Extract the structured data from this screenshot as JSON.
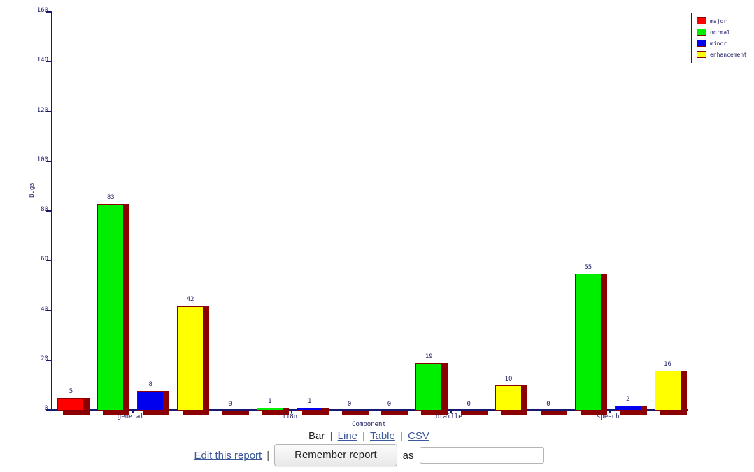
{
  "chart_data": {
    "type": "bar",
    "title": "",
    "xlabel": "Component",
    "ylabel": "Bugs",
    "ylim": [
      0,
      160
    ],
    "yticks": [
      0,
      20,
      40,
      60,
      80,
      100,
      120,
      140,
      160
    ],
    "grid": false,
    "legend_position": "right",
    "categories": [
      "general",
      "i18n",
      "braille",
      "speech"
    ],
    "series": [
      {
        "name": "major",
        "color": "#ff0000",
        "values": [
          5,
          0,
          0,
          0
        ]
      },
      {
        "name": "normal",
        "color": "#00ee00",
        "values": [
          83,
          1,
          19,
          55
        ]
      },
      {
        "name": "minor",
        "color": "#0000ee",
        "values": [
          8,
          1,
          0,
          2
        ]
      },
      {
        "name": "enhancement",
        "color": "#ffff00",
        "values": [
          42,
          0,
          10,
          16
        ]
      }
    ],
    "bar_outline_color": "#8b0000",
    "axis_color": "#191970",
    "text_color": "#1c1c64"
  },
  "footer": {
    "axis_title": "Component",
    "formats": {
      "current": "Bar",
      "links": [
        "Line",
        "Table",
        "CSV"
      ],
      "separator": "|"
    },
    "edit_link": "Edit this report",
    "separator": "|",
    "remember_button": "Remember report",
    "as_label": "as",
    "report_name_value": "",
    "report_name_placeholder": ""
  }
}
